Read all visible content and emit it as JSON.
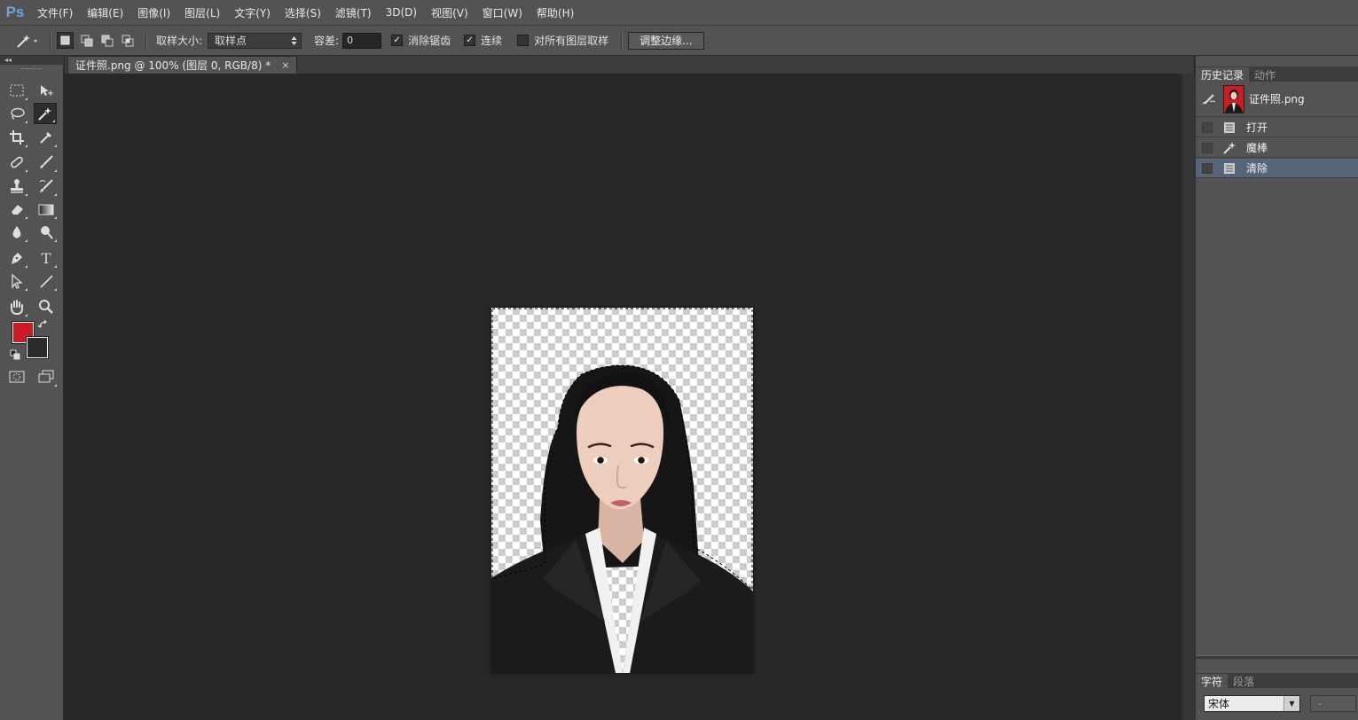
{
  "app": {
    "logo": "Ps"
  },
  "menu": [
    "文件(F)",
    "编辑(E)",
    "图像(I)",
    "图层(L)",
    "文字(Y)",
    "选择(S)",
    "滤镜(T)",
    "3D(D)",
    "视图(V)",
    "窗口(W)",
    "帮助(H)"
  ],
  "options": {
    "sample_size_label": "取样大小:",
    "sample_size_value": "取样点",
    "tolerance_label": "容差:",
    "tolerance_value": "0",
    "anti_alias_label": "消除锯齿",
    "anti_alias_checked": true,
    "contiguous_label": "连续",
    "contiguous_checked": true,
    "sample_all_layers_label": "对所有图层取样",
    "sample_all_layers_checked": false,
    "refine_edge_label": "调整边缘..."
  },
  "toolbox": {
    "collapse_glyph": "◂◂",
    "type_tool_glyph": "T",
    "foreground_color": "#cc1b23",
    "background_color": "#2b2b2b"
  },
  "document": {
    "tab_title": "证件照.png @ 100% (图层 0, RGB/8) *",
    "close_glyph": "×"
  },
  "history_panel": {
    "tabs": [
      "历史记录",
      "动作"
    ],
    "snapshot_name": "证件照.png",
    "steps": [
      {
        "label": "打开",
        "icon": "document-icon",
        "selected": false
      },
      {
        "label": "魔棒",
        "icon": "magic-wand-icon",
        "selected": false
      },
      {
        "label": "清除",
        "icon": "document-icon",
        "selected": true
      }
    ]
  },
  "character_panel": {
    "tabs": [
      "字符",
      "段落"
    ],
    "font_family": "宋体",
    "font_style": "-"
  }
}
